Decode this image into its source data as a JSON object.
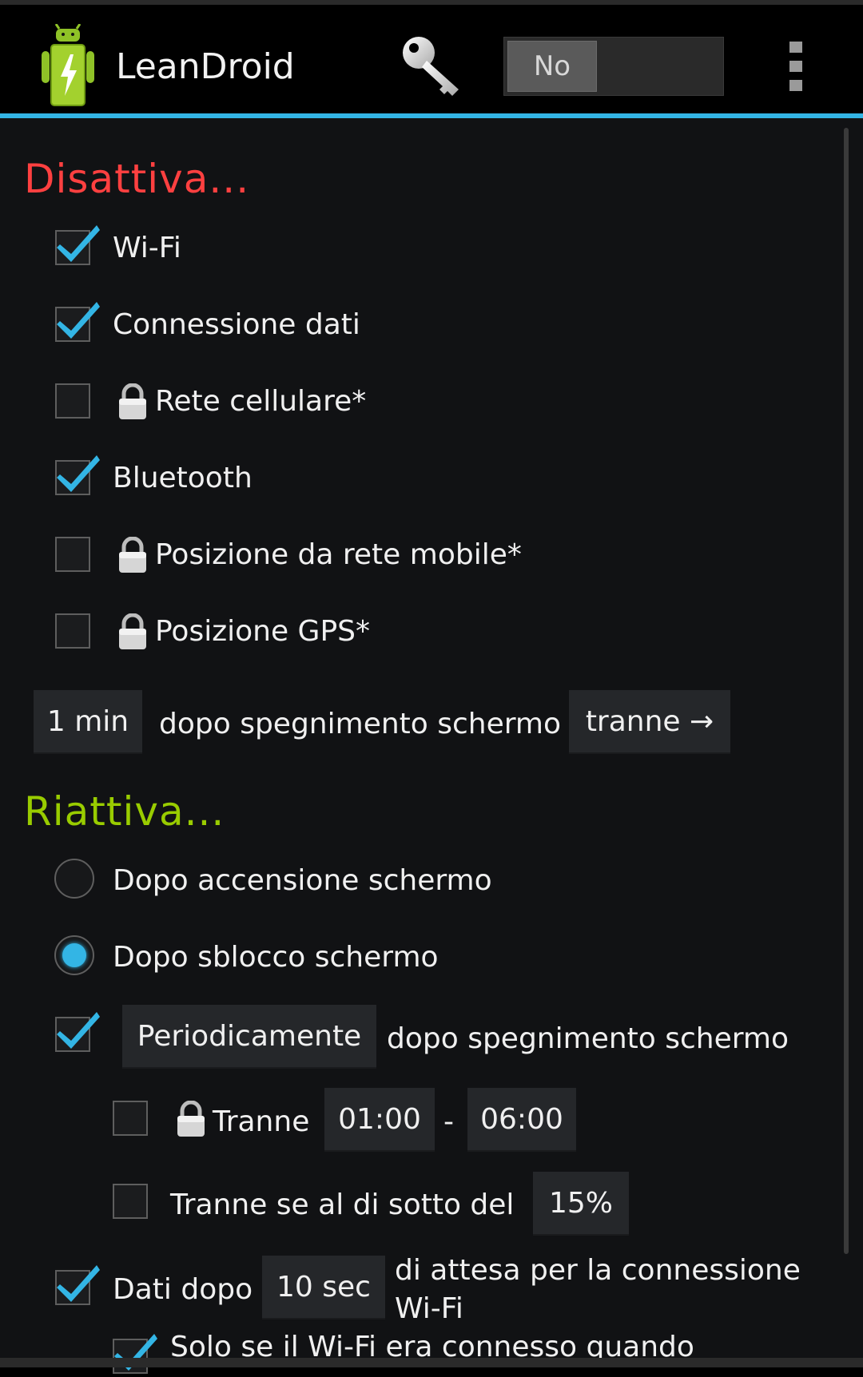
{
  "app": {
    "title": "LeanDroid",
    "toggle_label": "No",
    "accent": "#33b5e5"
  },
  "disable": {
    "heading": "Disattiva...",
    "heading_color": "#ff4040",
    "items": [
      {
        "label": "Wi-Fi",
        "checked": true,
        "locked": false
      },
      {
        "label": "Connessione dati",
        "checked": true,
        "locked": false
      },
      {
        "label": "Rete cellulare*",
        "checked": false,
        "locked": true
      },
      {
        "label": "Bluetooth",
        "checked": true,
        "locked": false
      },
      {
        "label": "Posizione da rete mobile*",
        "checked": false,
        "locked": true
      },
      {
        "label": "Posizione GPS*",
        "checked": false,
        "locked": true
      }
    ],
    "delay_value": "1 min",
    "delay_text": "dopo spegnimento schermo",
    "except_button": "tranne →"
  },
  "enable": {
    "heading": "Riattiva...",
    "heading_color": "#99cc00",
    "radios": [
      {
        "label": "Dopo accensione schermo",
        "selected": false
      },
      {
        "label": "Dopo sblocco schermo",
        "selected": true
      }
    ],
    "periodic": {
      "checked": true,
      "button": "Periodicamente",
      "text": "dopo spegnimento schermo"
    },
    "except_time": {
      "checked": false,
      "locked": true,
      "label": "Tranne",
      "from": "01:00",
      "dash": "-",
      "to": "06:00"
    },
    "except_battery": {
      "checked": false,
      "label": "Tranne se al di sotto del",
      "value": "15%"
    },
    "data_after": {
      "checked": true,
      "label": "Dati dopo",
      "value": "10 sec",
      "text_line1": "di attesa per la connessione",
      "text_line2": "Wi-Fi"
    },
    "only_if_wifi": {
      "checked": true,
      "label": "Solo se il Wi-Fi era connesso quando"
    }
  }
}
